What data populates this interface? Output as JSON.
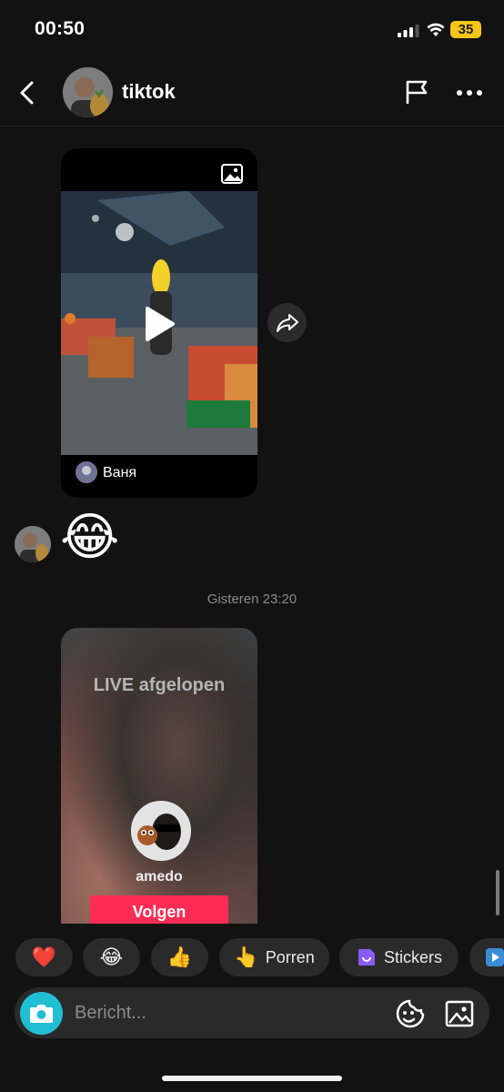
{
  "status_bar": {
    "time": "00:50",
    "battery": "35"
  },
  "header": {
    "title": "tiktok",
    "back_icon": "chevron-left-icon",
    "flag_icon": "flag-icon",
    "more_icon": "more-icon"
  },
  "messages": {
    "video_card": {
      "author": "Ваня",
      "media_icon": "image-icon",
      "play_icon": "play-icon",
      "share_icon": "share-icon"
    },
    "emoji_message": "😂",
    "timestamp": "Gisteren 23:20",
    "live_card": {
      "title": "LIVE afgelopen",
      "username": "amedo",
      "follow_label": "Volgen"
    }
  },
  "quick_replies": [
    {
      "icon": "❤️",
      "label": ""
    },
    {
      "icon": "😂",
      "label": ""
    },
    {
      "icon": "👍",
      "label": ""
    },
    {
      "icon": "👆",
      "label": "Porren"
    },
    {
      "icon": "sticker-icon",
      "label": "Stickers"
    }
  ],
  "composer": {
    "placeholder": "Bericht..."
  },
  "colors": {
    "background": "#121212",
    "accent": "#fe2c55",
    "camera": "#20bfd4",
    "battery": "#f5c518"
  }
}
